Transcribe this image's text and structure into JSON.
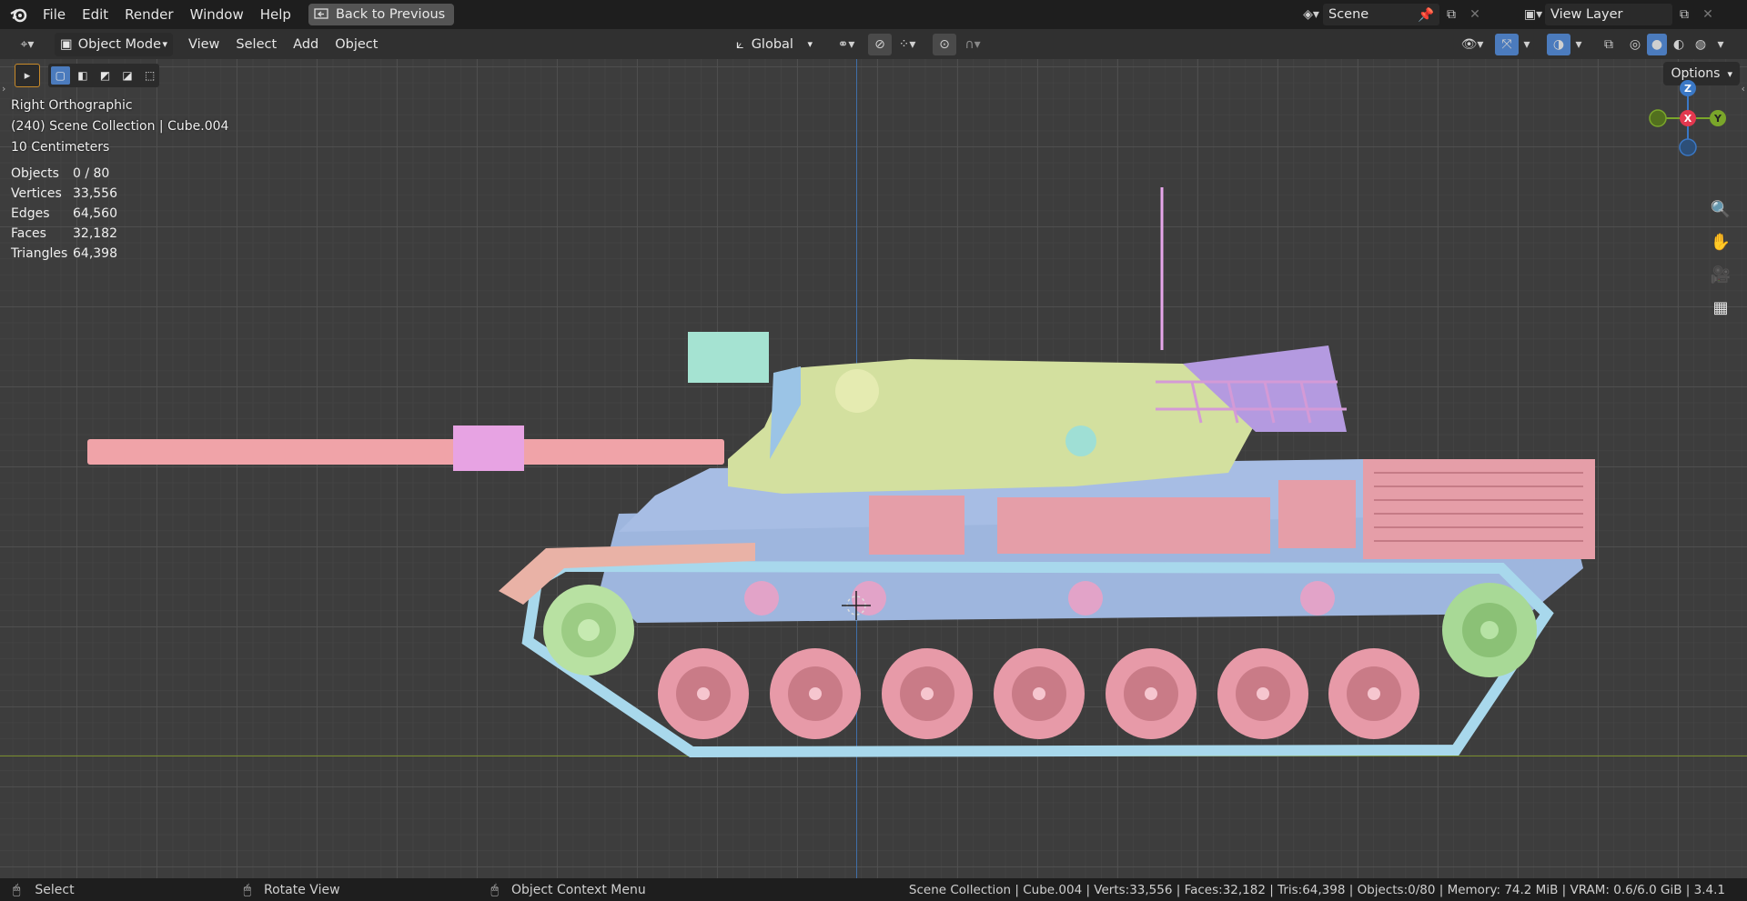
{
  "menubar": {
    "items": [
      "File",
      "Edit",
      "Render",
      "Window",
      "Help"
    ],
    "back_label": "Back to Previous",
    "scene_name": "Scene",
    "view_layer": "View Layer"
  },
  "header": {
    "mode": "Object Mode",
    "menus": [
      "View",
      "Select",
      "Add",
      "Object"
    ],
    "transform_orientation": "Global",
    "options_label": "Options"
  },
  "viewport": {
    "view_name": "Right Orthographic",
    "collection_line": "(240) Scene Collection | Cube.004",
    "scale_line": "10 Centimeters",
    "stats": [
      {
        "label": "Objects",
        "value": "0 / 80"
      },
      {
        "label": "Vertices",
        "value": "33,556"
      },
      {
        "label": "Edges",
        "value": "64,560"
      },
      {
        "label": "Faces",
        "value": "32,182"
      },
      {
        "label": "Triangles",
        "value": "64,398"
      }
    ],
    "gizmo": {
      "z": "Z",
      "x": "X",
      "y": "Y"
    }
  },
  "statusbar": {
    "select": "Select",
    "rotate": "Rotate View",
    "context": "Object Context Menu",
    "info": "Scene Collection | Cube.004 | Verts:33,556 | Faces:32,182 | Tris:64,398 | Objects:0/80 | Memory: 74.2 MiB | VRAM: 0.6/6.0 GiB | 3.4.1"
  }
}
